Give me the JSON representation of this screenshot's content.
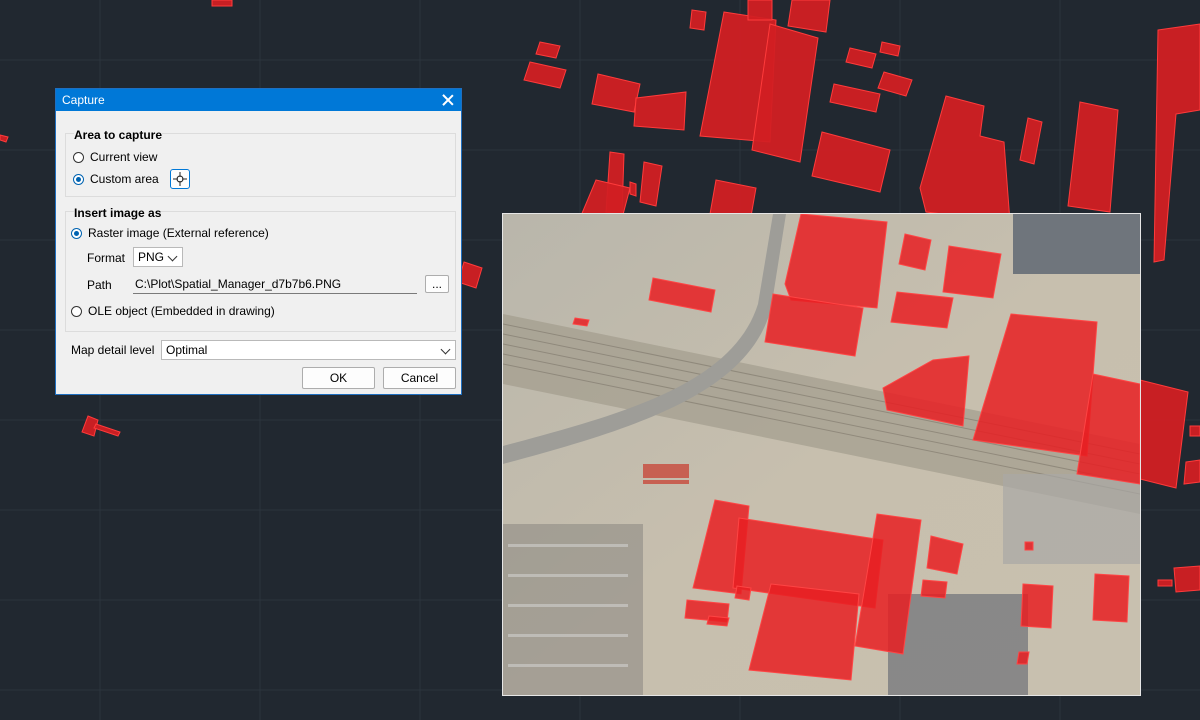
{
  "dialog": {
    "title": "Capture",
    "area_group": {
      "title": "Area to capture",
      "current_view_label": "Current view",
      "custom_area_label": "Custom area",
      "selected": "Custom area"
    },
    "insert_group": {
      "title": "Insert image as",
      "raster_label": "Raster image (External reference)",
      "format_label": "Format",
      "format_value": "PNG",
      "path_label": "Path",
      "path_value": "C:\\Plot\\Spatial_Manager_d7b7b6.PNG",
      "browse_label": "...",
      "ole_label": "OLE object (Embedded in drawing)",
      "selected": "Raster image (External reference)"
    },
    "map_detail_label": "Map detail level",
    "map_detail_value": "Optimal",
    "ok_label": "OK",
    "cancel_label": "Cancel"
  },
  "colors": {
    "canvas_background": "#212830",
    "building_fill": "#d21f23",
    "dialog_accent": "#0078d7"
  },
  "icons": {
    "close": "close-icon",
    "crosshair": "crosshair-icon",
    "dropdown": "chevron-down-icon"
  }
}
